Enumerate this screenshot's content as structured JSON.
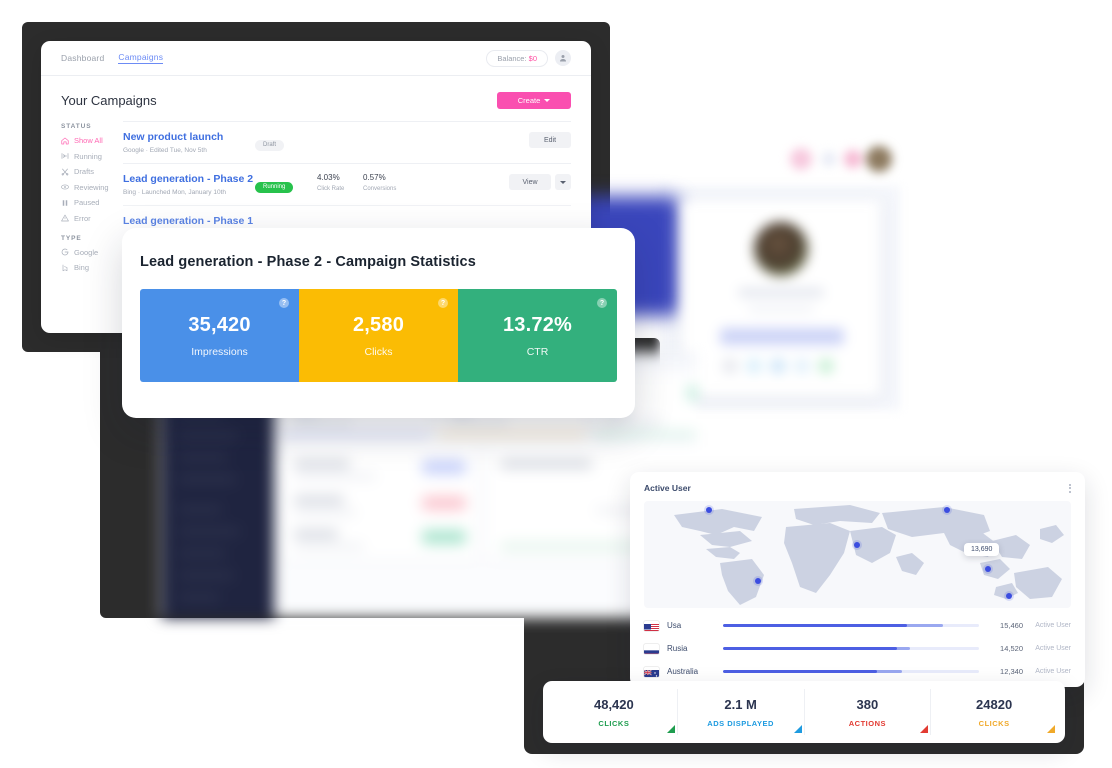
{
  "app": {
    "nav": [
      {
        "label": "Dashboard",
        "active": false
      },
      {
        "label": "Campaigns",
        "active": true
      }
    ],
    "balance_label": "Balance:",
    "balance_value": "$0",
    "avatar_icon": "user-icon",
    "page_title": "Your Campaigns",
    "create_label": "Create",
    "filters": {
      "status_title": "STATUS",
      "status_items": [
        {
          "label": "Show All",
          "icon": "home-icon",
          "active": true
        },
        {
          "label": "Running",
          "icon": "play-icon",
          "active": false
        },
        {
          "label": "Drafts",
          "icon": "scissors-icon",
          "active": false
        },
        {
          "label": "Reviewing",
          "icon": "eye-icon",
          "active": false
        },
        {
          "label": "Paused",
          "icon": "pause-icon",
          "active": false
        },
        {
          "label": "Error",
          "icon": "warning-icon",
          "active": false
        }
      ],
      "type_title": "TYPE",
      "type_items": [
        {
          "label": "Google",
          "icon": "google-icon"
        },
        {
          "label": "Bing",
          "icon": "bing-icon"
        }
      ]
    },
    "campaigns": [
      {
        "name": "New product launch",
        "sub": "Google  ·  Edited Tue, Nov 5th",
        "status": "Draft",
        "status_kind": "draft",
        "metrics": [],
        "action": "Edit",
        "has_dropdown": false
      },
      {
        "name": "Lead generation - Phase 2",
        "sub": "Bing  ·  Launched Mon, January 10th",
        "status": "Running",
        "status_kind": "running",
        "metrics": [
          {
            "value": "4.03%",
            "label": "Click Rate"
          },
          {
            "value": "0.57%",
            "label": "Conversions"
          }
        ],
        "action": "View",
        "has_dropdown": true
      }
    ]
  },
  "stats_modal": {
    "title": "Lead generation - Phase 2 - Campaign Statistics",
    "help_icon": "question-icon",
    "tiles": [
      {
        "value": "35,420",
        "label": "Impressions",
        "color": "#4a90e8"
      },
      {
        "value": "2,580",
        "label": "Clicks",
        "color": "#fbbc04"
      },
      {
        "value": "13.72%",
        "label": "CTR",
        "color": "#33b07d"
      }
    ]
  },
  "active_user": {
    "title": "Active User",
    "menu_icon": "kebab-menu-icon",
    "map_tooltip": "13,690",
    "rows": [
      {
        "country": "Usa",
        "flag": "flag-usa",
        "value": "15,460",
        "label": "Active User",
        "pctA": 72,
        "pctB": 86
      },
      {
        "country": "Rusia",
        "flag": "flag-russia",
        "value": "14,520",
        "label": "Active User",
        "pctA": 68,
        "pctB": 73
      },
      {
        "country": "Australia",
        "flag": "flag-australia",
        "value": "12,340",
        "label": "Active User",
        "pctA": 60,
        "pctB": 70
      }
    ]
  },
  "stats_bar": {
    "cells": [
      {
        "value": "48,420",
        "label": "CLICKS",
        "color": "#1f9d4f"
      },
      {
        "value": "2.1 M",
        "label": "ADS DISPLAYED",
        "color": "#1e9be0"
      },
      {
        "value": "380",
        "label": "ACTIONS",
        "color": "#e23b32"
      },
      {
        "value": "24820",
        "label": "CLICKS",
        "color": "#f0a92a"
      }
    ]
  }
}
